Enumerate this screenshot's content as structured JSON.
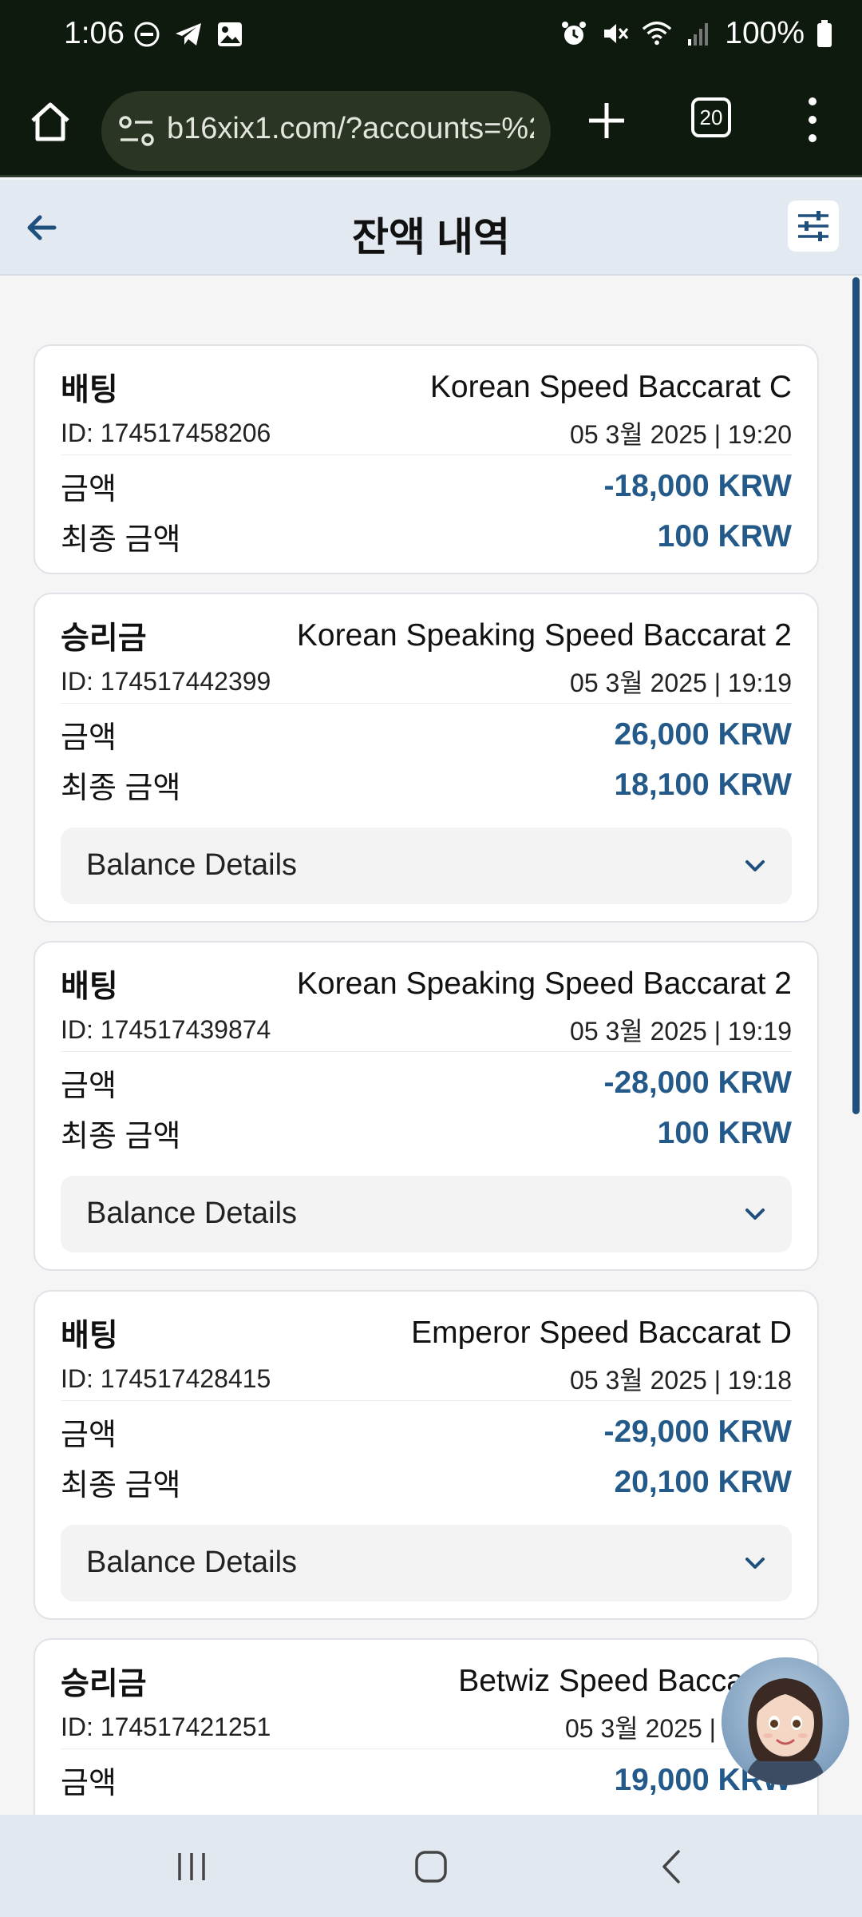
{
  "status_bar": {
    "time": "1:06",
    "battery": "100%",
    "left_icons": [
      "do-not-disturb-icon",
      "telegram-icon",
      "gallery-icon"
    ],
    "right_icons": [
      "alarm-icon",
      "mute-icon",
      "wifi-icon",
      "signal-icon",
      "battery-icon"
    ]
  },
  "browser": {
    "url": "b16xix1.com/?accounts=%2",
    "tab_count": "20"
  },
  "header": {
    "title": "잔액 내역"
  },
  "colors": {
    "accent": "#245a8a",
    "header_bg": "#e3e9f0",
    "browser_bg": "#0f1a0e"
  },
  "transactions": [
    {
      "type": "배팅",
      "game": "Korean Speed Baccarat C",
      "id": "ID: 174517458206",
      "datetime": "05 3월 2025 | 19:20",
      "amount_label": "금액",
      "amount": "-18,000 KRW",
      "final_label": "최종 금액",
      "final_amount": "100 KRW"
    },
    {
      "type": "승리금",
      "game": "Korean Speaking Speed Baccarat 2",
      "id": "ID: 174517442399",
      "datetime": "05 3월 2025 | 19:19",
      "amount_label": "금액",
      "amount": "26,000 KRW",
      "final_label": "최종 금액",
      "final_amount": "18,100 KRW",
      "details_label": "Balance Details"
    },
    {
      "type": "배팅",
      "game": "Korean Speaking Speed Baccarat 2",
      "id": "ID: 174517439874",
      "datetime": "05 3월 2025 | 19:19",
      "amount_label": "금액",
      "amount": "-28,000 KRW",
      "final_label": "최종 금액",
      "final_amount": "100 KRW",
      "details_label": "Balance Details"
    },
    {
      "type": "배팅",
      "game": "Emperor Speed Baccarat D",
      "id": "ID: 174517428415",
      "datetime": "05 3월 2025 | 19:18",
      "amount_label": "금액",
      "amount": "-29,000 KRW",
      "final_label": "최종 금액",
      "final_amount": "20,100 KRW",
      "details_label": "Balance Details"
    },
    {
      "type": "승리금",
      "game": "Betwiz Speed Bacca",
      "id": "ID: 174517421251",
      "datetime": "05 3월 2025 |",
      "amount_label": "금액",
      "amount": "19,000 KRW"
    }
  ]
}
